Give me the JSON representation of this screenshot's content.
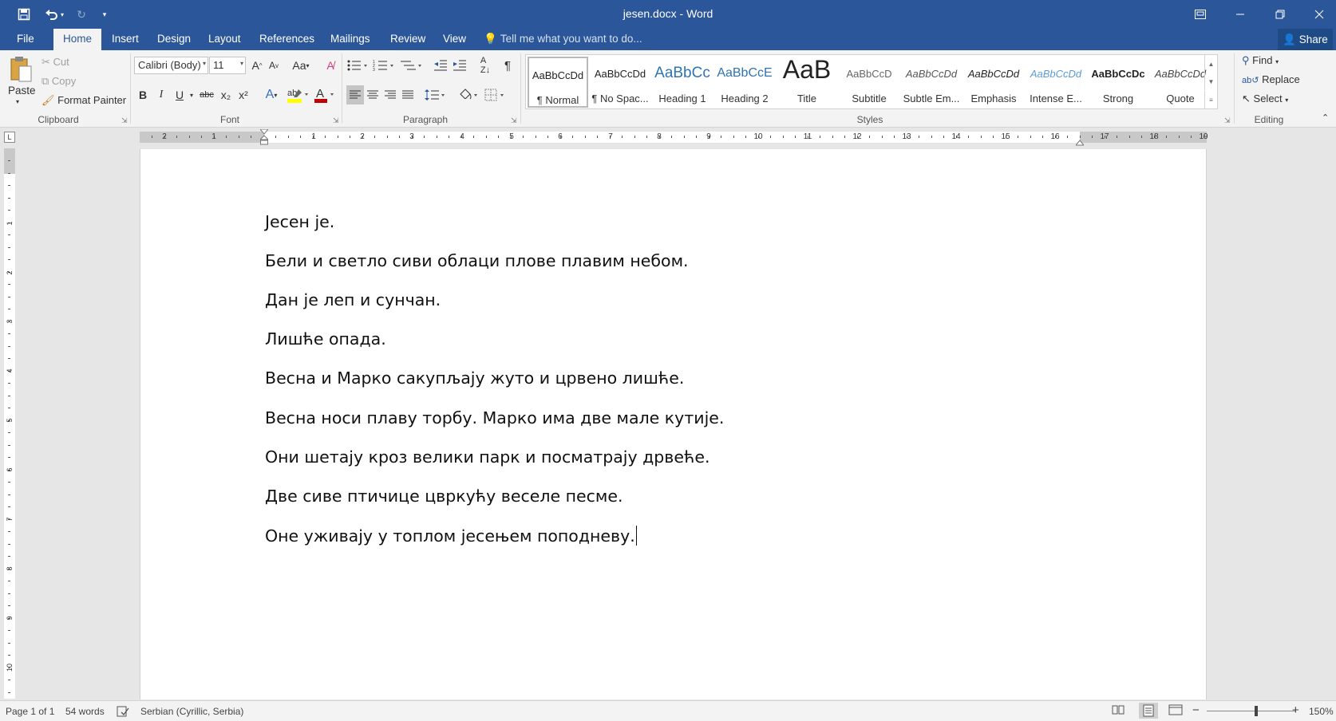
{
  "title_bar": {
    "document_title": "jesen.docx - Word",
    "qat": [
      "save-icon",
      "undo-icon",
      "redo-icon",
      "customize-icon"
    ],
    "window_controls": [
      "ribbon-display-icon",
      "minimize-icon",
      "restore-icon",
      "close-icon"
    ]
  },
  "tabs": [
    "File",
    "Home",
    "Insert",
    "Design",
    "Layout",
    "References",
    "Mailings",
    "Review",
    "View"
  ],
  "active_tab": "Home",
  "tell_me": "Tell me what you want to do...",
  "share_label": "Share",
  "clipboard": {
    "paste": "Paste",
    "cut": "Cut",
    "copy": "Copy",
    "format_painter": "Format Painter",
    "group_label": "Clipboard"
  },
  "font": {
    "family": "Calibri (Body)",
    "size": "11",
    "group_label": "Font",
    "bold": "B",
    "italic": "I",
    "underline": "U",
    "strike": "abc",
    "subscript": "x₂",
    "superscript": "x²",
    "change_case": "Aa",
    "highlight_color": "#ffff00",
    "font_color": "#c00000"
  },
  "paragraph": {
    "group_label": "Paragraph"
  },
  "styles": {
    "group_label": "Styles",
    "items": [
      {
        "preview": "AaBbCcDd",
        "name": "¶ Normal"
      },
      {
        "preview": "AaBbCcDd",
        "name": "¶ No Spac..."
      },
      {
        "preview": "AaBbCc",
        "name": "Heading 1"
      },
      {
        "preview": "AaBbCcE",
        "name": "Heading 2"
      },
      {
        "preview": "AaB",
        "name": "Title"
      },
      {
        "preview": "AaBbCcD",
        "name": "Subtitle"
      },
      {
        "preview": "AaBbCcDd",
        "name": "Subtle Em..."
      },
      {
        "preview": "AaBbCcDd",
        "name": "Emphasis"
      },
      {
        "preview": "AaBbCcDd",
        "name": "Intense E..."
      },
      {
        "preview": "AaBbCcDc",
        "name": "Strong"
      },
      {
        "preview": "AaBbCcDd",
        "name": "Quote"
      }
    ]
  },
  "editing": {
    "group_label": "Editing",
    "find": "Find",
    "replace": "Replace",
    "select": "Select"
  },
  "ruler": {
    "horizontal": [
      "2",
      "1",
      "1",
      "2",
      "3",
      "4",
      "5",
      "6",
      "7",
      "8",
      "9",
      "10",
      "11",
      "12",
      "13",
      "14",
      "15",
      "16",
      "17",
      "18",
      "19"
    ],
    "vertical": [
      "1",
      "2",
      "3",
      "4",
      "5",
      "6",
      "7",
      "8",
      "9",
      "10"
    ],
    "corner": "L"
  },
  "document": {
    "paragraphs": [
      "Јесен је.",
      "Бели и светло сиви облаци плове плавим небом.",
      "Дан је леп и сунчан.",
      "Лишће опада.",
      "Весна и Марко сакупљају жуто и црвено лишће.",
      "Весна носи плаву торбу. Марко има две мале кутије.",
      "Они шетају кроз велики парк и посматрају дрвеће.",
      "Две сиве птичице цвркућу веселе песме.",
      "Оне уживају у топлом јесењем поподневу."
    ]
  },
  "status_bar": {
    "page": "Page 1 of 1",
    "words": "54 words",
    "language": "Serbian (Cyrillic, Serbia)",
    "zoom": "150%",
    "zoom_minus": "−",
    "zoom_plus": "+"
  },
  "colors": {
    "accent": "#2b579a",
    "ribbon_bg": "#f3f3f3"
  }
}
